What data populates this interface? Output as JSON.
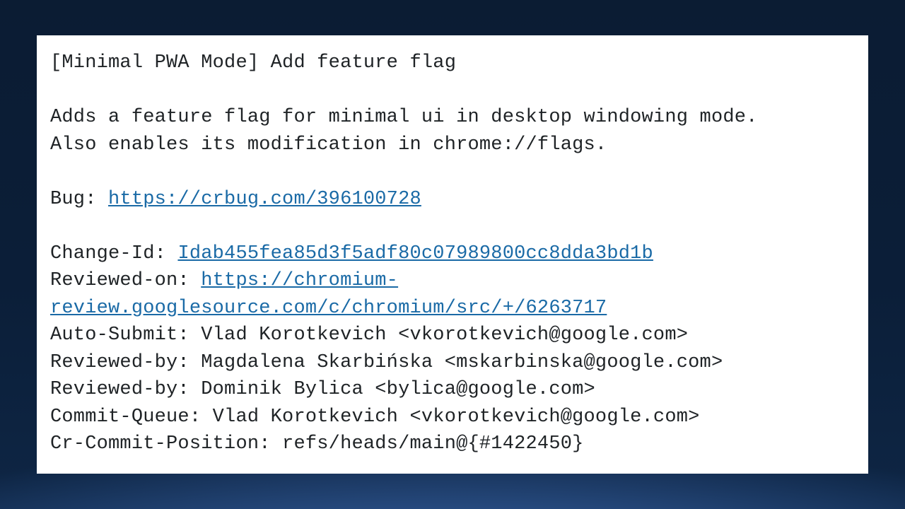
{
  "commit": {
    "title": "[Minimal PWA Mode] Add feature flag",
    "body1": "Adds a feature flag for minimal ui in desktop windowing mode.",
    "body2": "Also enables its modification in chrome://flags.",
    "bug_label": "Bug: ",
    "bug_url": "https://crbug.com/396100728",
    "changeid_label": "Change-Id: ",
    "changeid": "Idab455fea85d3f5adf80c07989800cc8dda3bd1b",
    "reviewedon_label": "Reviewed-on: ",
    "reviewedon_url": "https://chromium-review.googlesource.com/c/chromium/src/+/6263717",
    "auto_submit": "Auto-Submit: Vlad Korotkevich <vkorotkevich@google.com>",
    "reviewed_by1": "Reviewed-by: Magdalena Skarbińska <mskarbinska@google.com>",
    "reviewed_by2": "Reviewed-by: Dominik Bylica <bylica@google.com>",
    "commit_queue": "Commit-Queue: Vlad Korotkevich <vkorotkevich@google.com>",
    "cr_position": "Cr-Commit-Position: refs/heads/main@{#1422450}"
  }
}
